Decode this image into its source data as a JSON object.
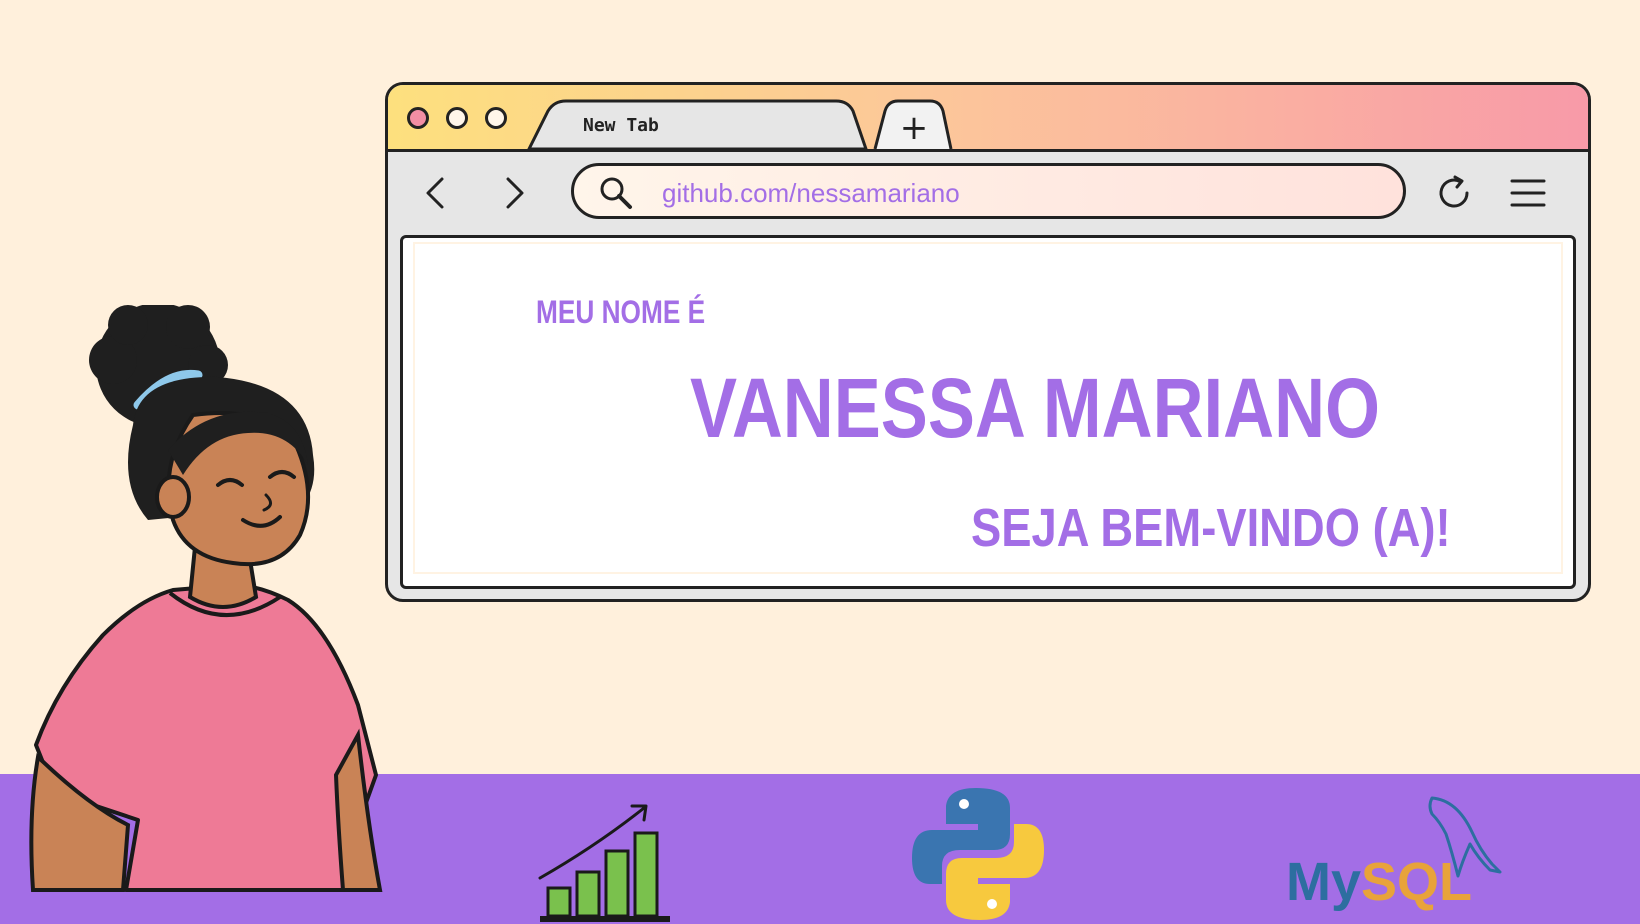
{
  "browser": {
    "tab_label": "New Tab",
    "new_tab_symbol": "+",
    "address": "github.com/nessamariano"
  },
  "page": {
    "greeting": "MEU NOME É",
    "name": "VANESSA MARIANO",
    "welcome": "SEJA BEM-VINDO (A)!"
  },
  "icons": {
    "mysql_text": "MySQL"
  },
  "colors": {
    "background": "#fff0dc",
    "accent_purple": "#a36ee6",
    "shirt_pink": "#ee7a96"
  }
}
